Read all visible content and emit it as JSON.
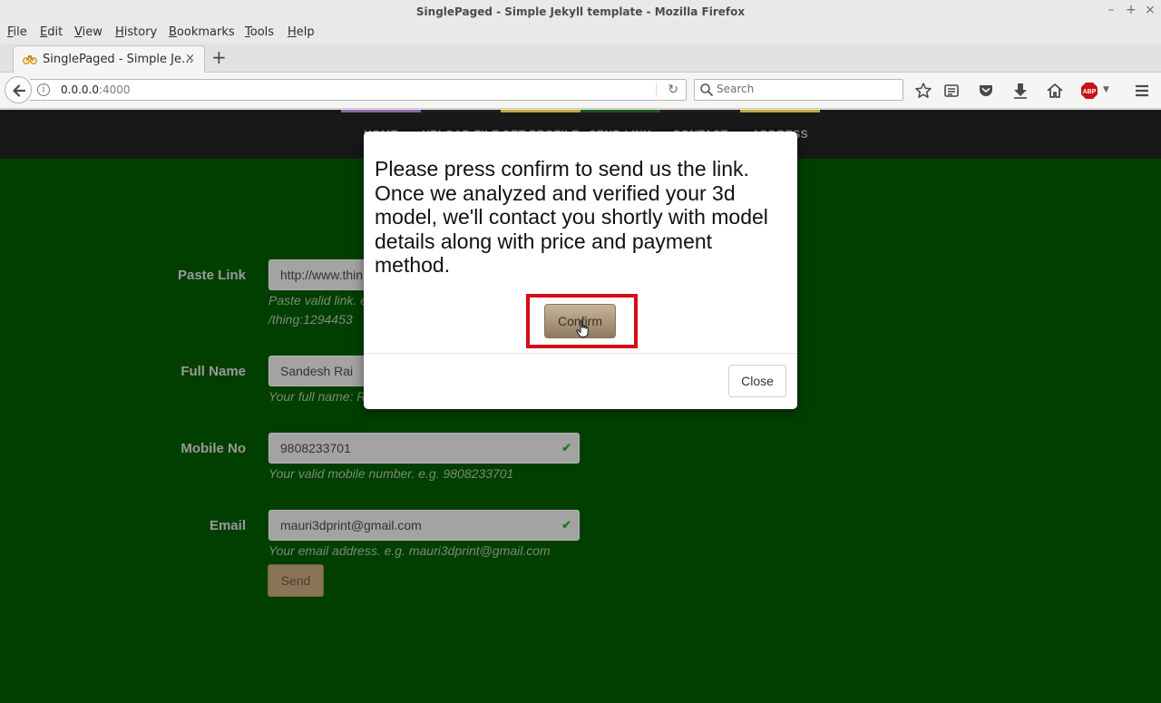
{
  "window": {
    "title": "SinglePaged - Simple Jekyll template - Mozilla Firefox",
    "controls": [
      "–",
      "+",
      "×"
    ]
  },
  "menu": [
    "File",
    "Edit",
    "View",
    "History",
    "Bookmarks",
    "Tools",
    "Help"
  ],
  "tab": {
    "title": "SinglePaged - Simple Je…",
    "close": "×",
    "new_tab": "+"
  },
  "navbar": {
    "url_host": "0.0.0.0",
    "url_port": ":4000",
    "search_placeholder": "Search",
    "adblock_label": "ABP"
  },
  "site_nav": {
    "items": [
      {
        "label": "HOME",
        "color": "#8a6aa8"
      },
      {
        "label": "UPLOAD FILE",
        "color": "#202020"
      },
      {
        "label": "GET PROFILE",
        "color": "#c8a83a"
      },
      {
        "label": "SEND LINK",
        "color": "#1a5a1a"
      },
      {
        "label": "CONTACT",
        "color": "#202020"
      },
      {
        "label": "ADDRESS",
        "color": "#c8a83a"
      }
    ]
  },
  "form": {
    "paste_link": {
      "label": "Paste Link",
      "value": "http://www.thin",
      "help_line1": "Paste valid link. e",
      "help_line2": "/thing:1294453"
    },
    "full_name": {
      "label": "Full Name",
      "value": "Sandesh Rai",
      "help": "Your full name: R"
    },
    "mobile": {
      "label": "Mobile No",
      "value": "9808233701",
      "help": "Your valid mobile number. e.g. 9808233701"
    },
    "email": {
      "label": "Email",
      "value": "mauri3dprint@gmail.com",
      "help": "Your email address. e.g. mauri3dprint@gmail.com"
    },
    "send_label": "Send"
  },
  "modal": {
    "message": "Please press confirm to send us the link. Once we analyzed and verified your 3d model, we'll contact you shortly with model details along with price and payment method.",
    "confirm_label": "Confirm",
    "close_label": "Close"
  }
}
